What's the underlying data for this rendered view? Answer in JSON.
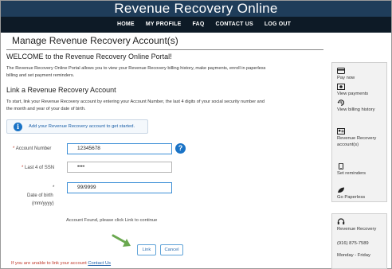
{
  "header": {
    "site_title": "Revenue Recovery Online"
  },
  "nav": {
    "items": [
      "HOME",
      "MY PROFILE",
      "FAQ",
      "CONTACT US",
      "LOG OUT"
    ]
  },
  "page": {
    "title": "Manage Revenue Recovery Account(s)"
  },
  "welcome": {
    "heading": "WELCOME to the Revenue Recovery Online Portal!",
    "description": "The Revenue Recovery Online Portal allows you to view your Revenue Recovery billing history, make payments, enroll in paperless billing and set payment reminders."
  },
  "link_section": {
    "heading": "Link a Revenue Recovery Account",
    "description": "To start, link your Revenue Recovery account by entering your Account Number, the last 4 digits of your social security number and the month and year of your date of birth.",
    "info_text": "Add your Revenue Recovery account to get started."
  },
  "form": {
    "account_label": "Account Number",
    "account_value": "12345678",
    "ssn_label": "Last 4 of SSN",
    "ssn_value": "••••",
    "dob_label": "Date of birth",
    "dob_format": "(mm/yyyy)",
    "dob_value": "99/9999",
    "required_mark": "*",
    "help_glyph": "?",
    "status_message": "Account Found, please click Link to continue",
    "link_button": "Link",
    "cancel_button": "Cancel"
  },
  "footer": {
    "unable_text": "If you are unable to link your account ",
    "contact_link": "Contact Us"
  },
  "sidebar": {
    "pay_now": "Pay now",
    "view_payments": "View payments",
    "view_billing_history": "View billing history",
    "revenue_recovery_accounts": "Revenue Recovery account(s)",
    "set_reminders": "Set reminders",
    "go_paperless": "Go Paperless"
  },
  "contact": {
    "name": "Revenue Recovery",
    "phone": "(916) 875-7589",
    "hours": "Monday - Friday"
  },
  "colors": {
    "topbar": "#1f3d5a",
    "navbar": "#0d1a26",
    "accent_blue": "#1a73c6",
    "required_red": "#c0392b",
    "arrow_green": "#6aa84f"
  }
}
